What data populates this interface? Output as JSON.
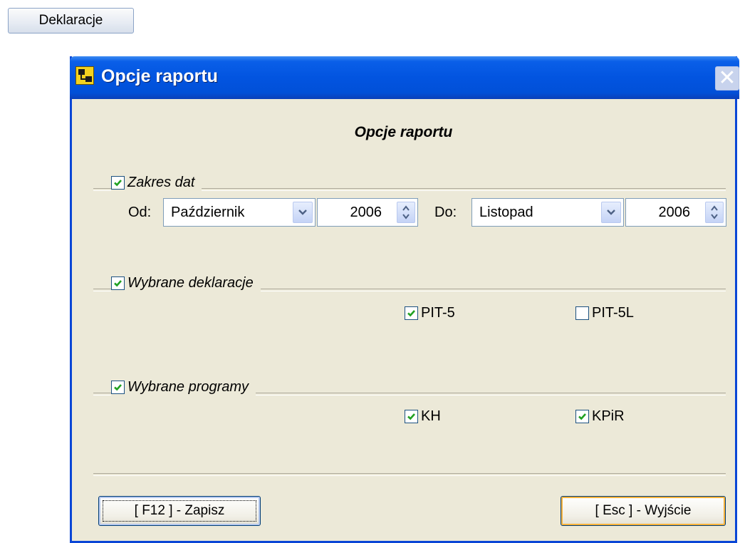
{
  "toolbar": {
    "declarations_label": "Deklaracje"
  },
  "dialog": {
    "title": "Opcje raportu",
    "close_glyph": "✕",
    "heading": "Opcje raportu",
    "date_range": {
      "label": "Zakres dat",
      "checked": true,
      "from_label": "Od:",
      "from_month": "Październik",
      "from_year": "2006",
      "to_label": "Do:",
      "to_month": "Listopad",
      "to_year": "2006"
    },
    "declarations": {
      "label": "Wybrane deklaracje",
      "checked": true,
      "items": [
        {
          "label": "PIT-5",
          "checked": true
        },
        {
          "label": "PIT-5L",
          "checked": false
        }
      ]
    },
    "programs": {
      "label": "Wybrane programy",
      "checked": true,
      "items": [
        {
          "label": "KH",
          "checked": true
        },
        {
          "label": "KPiR",
          "checked": true
        }
      ]
    },
    "buttons": {
      "save_label": "[ F12 ] - Zapisz",
      "exit_label": "[ Esc ] - Wyjście"
    }
  },
  "colors": {
    "titlebar": "#0254e0",
    "dialog_bg": "#ece9d8",
    "check_mark": "#21a121"
  }
}
